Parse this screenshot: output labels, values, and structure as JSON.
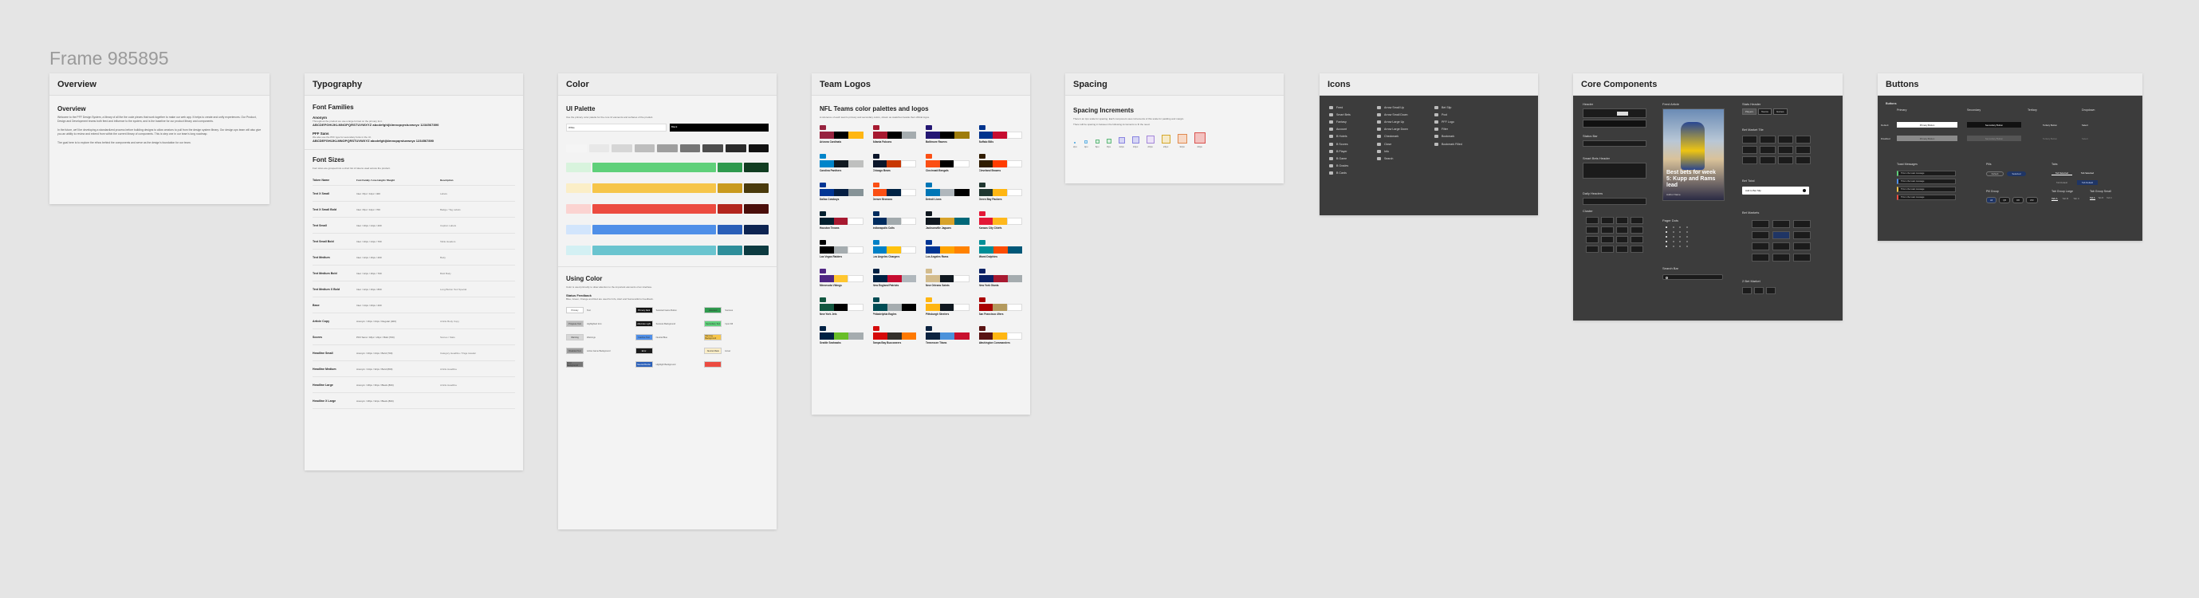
{
  "frame_title": "Frame 985895",
  "overview": {
    "header": "Overview",
    "title": "Overview",
    "p1": "Welcome to the PFF Design System, a library of all the the code pieces that work together to make our web app. It helps to create and unify experiences. Our Product, Design and Development teams both feed and influence to the system, and is the baseline for our product library and components.",
    "p2": "In the future, we'll be developing a standardized process before building designs to allow creators to pull from the design system library. Our design ops team will also give you an ability to review and extend from within the current library of components. This is step one in our team's long roadmap.",
    "p3": "The goal here is to explore the ethos behind the components and serve as the design's foundation for our team."
  },
  "typography": {
    "header": "Typography",
    "families_title": "Font Families",
    "font1_name": "Anonym",
    "font1_desc": "Throughout the product we use a large format on the primary font.",
    "font1_sample": "ABCDEFGHIJKLMNOPQRSTUVWXYZ abcdefghijklmnopqrstuvwxyz 1234567890",
    "font2_name": "PFF Sans",
    "font2_desc": "We also use the PFF type for secondary fonts in the UI.",
    "font2_sample": "ABCDEFGHIJKLMNOPQRSTUVWXYZ abcdefghijklmnopqrstuvwxyz 1234567890",
    "sizes_title": "Font Sizes",
    "sizes_intro": "Font sizes are grouped into a short list of tokens used across the product.",
    "col_token": "Token Name",
    "col_spec": "Font Family / Line Height / Weight",
    "col_desc": "Description",
    "rows": [
      {
        "name": "Text X Small",
        "spec": "Inter / 8px / 12px / 400",
        "desc": "Labels"
      },
      {
        "name": "Text X Small Bold",
        "spec": "Inter / 8px / 12px / 700",
        "desc": "Badge / Tag Labels"
      },
      {
        "name": "Text Small",
        "spec": "Inter / 10px / 14px / 400",
        "desc": "Caption Labels"
      },
      {
        "name": "Text Small Bold",
        "spec": "Inter / 10px / 14px / 700",
        "desc": "Table Headers"
      },
      {
        "name": "Text Medium",
        "spec": "Inter / 12px / 16px / 400",
        "desc": "Body"
      },
      {
        "name": "Text Medium Bold",
        "spec": "Inter / 12px / 16px / 700",
        "desc": "Bold Body"
      },
      {
        "name": "Text Medium X Bold",
        "spec": "Inter / 12px / 16px / 800",
        "desc": "Long Button Text Special"
      },
      {
        "name": "Base",
        "spec": "Inter / 14px / 20px / 400",
        "desc": ""
      },
      {
        "name": "Article Copy",
        "spec": "Anonym / 16px / 24px / Regular (400)",
        "desc": "Article Body Copy"
      },
      {
        "name": "Scores",
        "spec": "PFF Sans / 18px / 24px / Bold (700)",
        "desc": "Scores / Stats"
      },
      {
        "name": "Headline Small",
        "spec": "Anonym / 20px / 24px / Bold (700)",
        "desc": "Category Headline / Page Header"
      },
      {
        "name": "Headline Medium",
        "spec": "Anonym / 24px / 32px / Bold (800)",
        "desc": "Article Headline"
      },
      {
        "name": "Headline Large",
        "spec": "Anonym / 28px / 36px / Black (800)",
        "desc": "Article Headline"
      },
      {
        "name": "Headline X Large",
        "spec": "Anonym / 28px / 32px / Black (800)",
        "desc": ""
      }
    ]
  },
  "color": {
    "header": "Color",
    "palette_title": "UI Palette",
    "palette_desc": "Use the primary color palette for the core UI elements and surfaces of the product.",
    "white_label": "White",
    "black_label": "Black",
    "using_title": "Using Color",
    "using_desc": "Color is used primarily to draw attention to the important elements of an interface.",
    "status_title": "Status Feedback",
    "status_desc": "Blue, Green, Orange and Red are used for Info, Alert and Success/Error feedback.",
    "status_items": [
      [
        "Primary",
        "Text"
      ],
      [
        "Primary Dark",
        "Selected Game Button"
      ],
      [
        "Elevated",
        "Success"
      ],
      [
        "Progress Text",
        "Highlighted Icon"
      ],
      [
        "Alternate Light",
        "Success Background"
      ],
      [
        "Secondary Text",
        "Input Fill"
      ],
      [
        "Warning",
        "Warnings"
      ],
      [
        "Inactive Text",
        "Neutral Blue"
      ],
      [
        "Warning Background",
        ""
      ],
      [
        "Disabled Text",
        "Active Game Background"
      ],
      [
        "Error",
        ""
      ],
      [
        "Neutral Mask",
        "Hover"
      ],
      [
        "Error Background",
        ""
      ],
      [
        "Neutral Border",
        "Highlight Background"
      ],
      [
        "",
        ""
      ]
    ]
  },
  "logos": {
    "header": "Team Logos",
    "title": "NFL Teams color palettes and logos",
    "desc": "A reference of each team's primary and secondary colors, shown as swatches beside their official logos.",
    "teams": [
      {
        "name": "Arizona Cardinals",
        "c": [
          "#97233F",
          "#000000",
          "#FFB612"
        ]
      },
      {
        "name": "Atlanta Falcons",
        "c": [
          "#A71930",
          "#000000",
          "#A5ACAF"
        ]
      },
      {
        "name": "Baltimore Ravens",
        "c": [
          "#241773",
          "#000000",
          "#9E7C0C"
        ]
      },
      {
        "name": "Buffalo Bills",
        "c": [
          "#00338D",
          "#C60C30",
          "#FFFFFF"
        ]
      },
      {
        "name": "Carolina Panthers",
        "c": [
          "#0085CA",
          "#101820",
          "#BFC0BF"
        ]
      },
      {
        "name": "Chicago Bears",
        "c": [
          "#0B162A",
          "#C83803",
          "#FFFFFF"
        ]
      },
      {
        "name": "Cincinnati Bengals",
        "c": [
          "#FB4F14",
          "#000000",
          "#FFFFFF"
        ]
      },
      {
        "name": "Cleveland Browns",
        "c": [
          "#311D00",
          "#FF3C00",
          "#FFFFFF"
        ]
      },
      {
        "name": "Dallas Cowboys",
        "c": [
          "#003594",
          "#041E42",
          "#869397"
        ]
      },
      {
        "name": "Denver Broncos",
        "c": [
          "#FB4F14",
          "#002244",
          "#FFFFFF"
        ]
      },
      {
        "name": "Detroit Lions",
        "c": [
          "#0076B6",
          "#B0B7BC",
          "#000000"
        ]
      },
      {
        "name": "Green Bay Packers",
        "c": [
          "#203731",
          "#FFB612",
          "#FFFFFF"
        ]
      },
      {
        "name": "Houston Texans",
        "c": [
          "#03202F",
          "#A71930",
          "#FFFFFF"
        ]
      },
      {
        "name": "Indianapolis Colts",
        "c": [
          "#002C5F",
          "#A2AAAD",
          "#FFFFFF"
        ]
      },
      {
        "name": "Jacksonville Jaguars",
        "c": [
          "#101820",
          "#D7A22A",
          "#006778"
        ]
      },
      {
        "name": "Kansas City Chiefs",
        "c": [
          "#E31837",
          "#FFB81C",
          "#FFFFFF"
        ]
      },
      {
        "name": "Las Vegas Raiders",
        "c": [
          "#000000",
          "#A5ACAF",
          "#FFFFFF"
        ]
      },
      {
        "name": "Los Angeles Chargers",
        "c": [
          "#0080C6",
          "#FFC20E",
          "#FFFFFF"
        ]
      },
      {
        "name": "Los Angeles Rams",
        "c": [
          "#003594",
          "#FFA300",
          "#FF8200"
        ]
      },
      {
        "name": "Miami Dolphins",
        "c": [
          "#008E97",
          "#FC4C02",
          "#005778"
        ]
      },
      {
        "name": "Minnesota Vikings",
        "c": [
          "#4F2683",
          "#FFC62F",
          "#FFFFFF"
        ]
      },
      {
        "name": "New England Patriots",
        "c": [
          "#002244",
          "#C60C30",
          "#B0B7BC"
        ]
      },
      {
        "name": "New Orleans Saints",
        "c": [
          "#D3BC8D",
          "#101820",
          "#FFFFFF"
        ]
      },
      {
        "name": "New York Giants",
        "c": [
          "#0B2265",
          "#A71930",
          "#A5ACAF"
        ]
      },
      {
        "name": "New York Jets",
        "c": [
          "#125740",
          "#000000",
          "#FFFFFF"
        ]
      },
      {
        "name": "Philadelphia Eagles",
        "c": [
          "#004C54",
          "#A5ACAF",
          "#000000"
        ]
      },
      {
        "name": "Pittsburgh Steelers",
        "c": [
          "#FFB612",
          "#101820",
          "#FFFFFF"
        ]
      },
      {
        "name": "San Francisco 49ers",
        "c": [
          "#AA0000",
          "#B3995D",
          "#FFFFFF"
        ]
      },
      {
        "name": "Seattle Seahawks",
        "c": [
          "#002244",
          "#69BE28",
          "#A5ACAF"
        ]
      },
      {
        "name": "Tampa Bay Buccaneers",
        "c": [
          "#D50A0A",
          "#34302B",
          "#FF7900"
        ]
      },
      {
        "name": "Tennessee Titans",
        "c": [
          "#0C2340",
          "#4B92DB",
          "#C8102E"
        ]
      },
      {
        "name": "Washington Commanders",
        "c": [
          "#5A1414",
          "#FFB612",
          "#FFFFFF"
        ]
      }
    ]
  },
  "spacing": {
    "header": "Spacing",
    "title": "Spacing Increments",
    "desc": "There's an 4px scale for spacing. Each component uses increments of this scale for padding and margin.",
    "note": "There will be spacing in between the following increments to fit the need.",
    "items": [
      {
        "label": "2px"
      },
      {
        "label": "4px"
      },
      {
        "label": "6px"
      },
      {
        "label": "8px"
      },
      {
        "label": "12px"
      },
      {
        "label": "16px"
      },
      {
        "label": "20px"
      },
      {
        "label": "24px"
      },
      {
        "label": "32px"
      },
      {
        "label": "40px"
      }
    ]
  },
  "icons": {
    "header": "Icons",
    "col1": [
      "Feed",
      "Smart Bets",
      "Fantasy",
      "Account",
      "B Hotels",
      "B Scores",
      "B Player",
      "B Game",
      "B Grades",
      "B Cards"
    ],
    "col2": [
      "Arrow Small Up",
      "Arrow Small Down",
      "Arrow Large Up",
      "Arrow Large Down",
      "Checkmark",
      "Close",
      "Info",
      "Search"
    ],
    "col3": [
      "Bet Slip",
      "Pool",
      "PFF Logo",
      "Filter",
      "Bookmark",
      "Bookmark Filled"
    ]
  },
  "components": {
    "header": "Core Components",
    "labels": {
      "header": "Header",
      "status_bar": "Status Bar",
      "smart_bets_header": "Smart Bets Header",
      "daily_headers": "Daily Headers",
      "cluster": "Cluster",
      "feed_article": "Feed Article",
      "pager_dots": "Pager Dots",
      "search_bar": "Search Bar",
      "stats_header": "Stats Header",
      "bet_market_tile": "Bet Market Tile",
      "bet_total": "Bet Total",
      "bet_markets": "Bet Markets",
      "bet_market_2": "2 Bet Market"
    },
    "article_headline": "Best bets for week 5: Kupp and Rams lead",
    "article_author": "Author Name",
    "tabs": [
      "Players",
      "Teams",
      "Games"
    ],
    "bet_total_text": "Add to Bet Slip"
  },
  "buttons": {
    "header": "Buttons",
    "title": "Buttons",
    "cols": [
      "Primary",
      "Secondary",
      "Tertiary",
      "Dropdown"
    ],
    "rows": [
      "Default",
      "Disabled"
    ],
    "primary_label": "Primary Button",
    "secondary_label": "Secondary Button",
    "tertiary_label": "Tertiary Button",
    "dropdown_label": "Select",
    "toast_title": "Toast Messages",
    "pills_title": "Pills",
    "tabs_title": "Tabs",
    "pill_group_title": "Pill Group",
    "tab_large_title": "Tab Group Large",
    "tab_small_title": "Tab Group Small",
    "pill_default": "Default",
    "pill_selected": "Selected",
    "tab_selected": "Tab Selected",
    "tab_default": "Tab Default",
    "toasts": [
      "This is the toast message",
      "This is the toast message",
      "This is the toast message",
      "This is the toast message"
    ],
    "pill_group": [
      "All",
      "QB",
      "RB",
      "WR"
    ],
    "tab_group_small": [
      "Tab A",
      "Tab B",
      "Tab C"
    ],
    "tab_group_large": [
      "Tab A",
      "Tab B",
      "Tab C"
    ]
  }
}
